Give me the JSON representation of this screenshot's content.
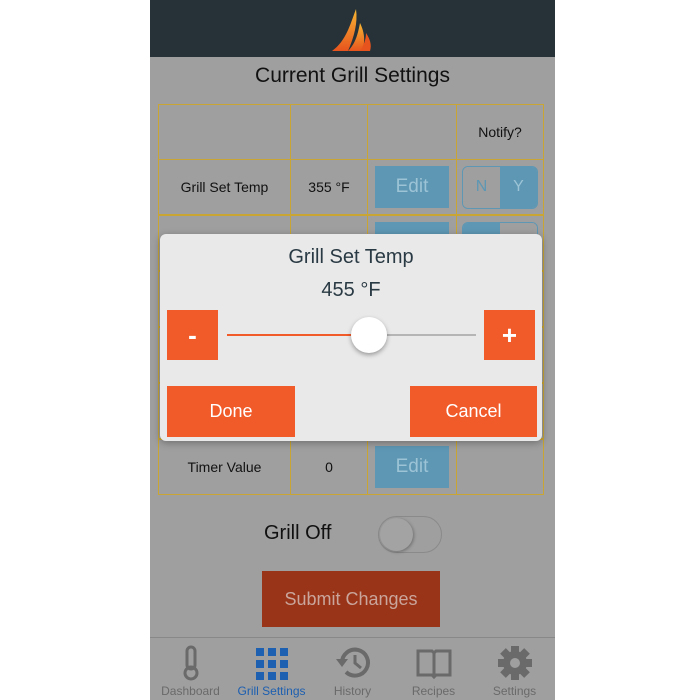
{
  "header": {
    "logo": "flame-logo"
  },
  "title": "Current Grill Settings",
  "table": {
    "notify_header": "Notify?",
    "rows": [
      {
        "label": "Grill Set Temp",
        "value": "355 °F",
        "edit": "Edit",
        "notify": "Y",
        "n": "N",
        "y": "Y"
      },
      {
        "label": "",
        "value": "",
        "edit": "Edit",
        "notify": "N"
      },
      {
        "label": "Timer Value",
        "value": "0",
        "edit": "Edit"
      }
    ]
  },
  "dialog": {
    "title": "Grill Set Temp",
    "value": "455 °F",
    "minus": "-",
    "plus": "+",
    "slider_fraction": 0.57,
    "done": "Done",
    "cancel": "Cancel"
  },
  "grill_off": {
    "label": "Grill Off",
    "on": false
  },
  "submit": "Submit Changes",
  "tabs": [
    {
      "label": "Dashboard",
      "icon": "thermometer-icon"
    },
    {
      "label": "Grill Settings",
      "icon": "grid-icon",
      "active": true
    },
    {
      "label": "History",
      "icon": "history-icon"
    },
    {
      "label": "Recipes",
      "icon": "book-icon"
    },
    {
      "label": "Settings",
      "icon": "gear-icon"
    }
  ],
  "colors": {
    "accent": "#f15a29",
    "header": "#263238",
    "edit": "#5d97b4",
    "active_tab": "#1d5fb0",
    "table_border": "#c9a634"
  }
}
